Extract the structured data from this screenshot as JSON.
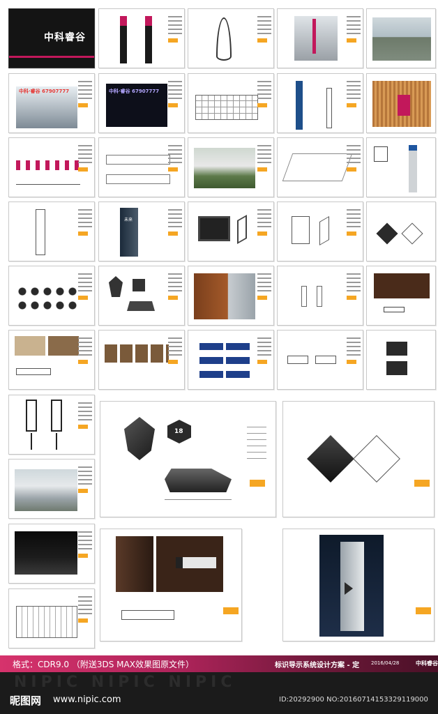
{
  "cover": {
    "logo_text": "中科睿谷"
  },
  "sample_labels": {
    "storefront_day": "中科·睿谷 67907777",
    "storefront_night": "中科·睿谷 67907777",
    "totem_small": "未来",
    "room_number": "18"
  },
  "band": {
    "format_text": "格式：CDR9.0 （附送3DS MAX效果图原文件）",
    "plan_title": "标识导示系统设计方案 - 定",
    "plan_date": "2016/04/28",
    "logo_text": "中科睿谷"
  },
  "footer": {
    "watermark": "NIPIC NIPIC NIPIC",
    "site_logo": "昵图网",
    "site_url": "www.nipic.com",
    "image_id": "ID:20292900 NO:20160714153329119000"
  },
  "colors": {
    "accent_magenta": "#c2185b",
    "accent_orange": "#f5a623",
    "dark_bg": "#1b1b1b"
  }
}
